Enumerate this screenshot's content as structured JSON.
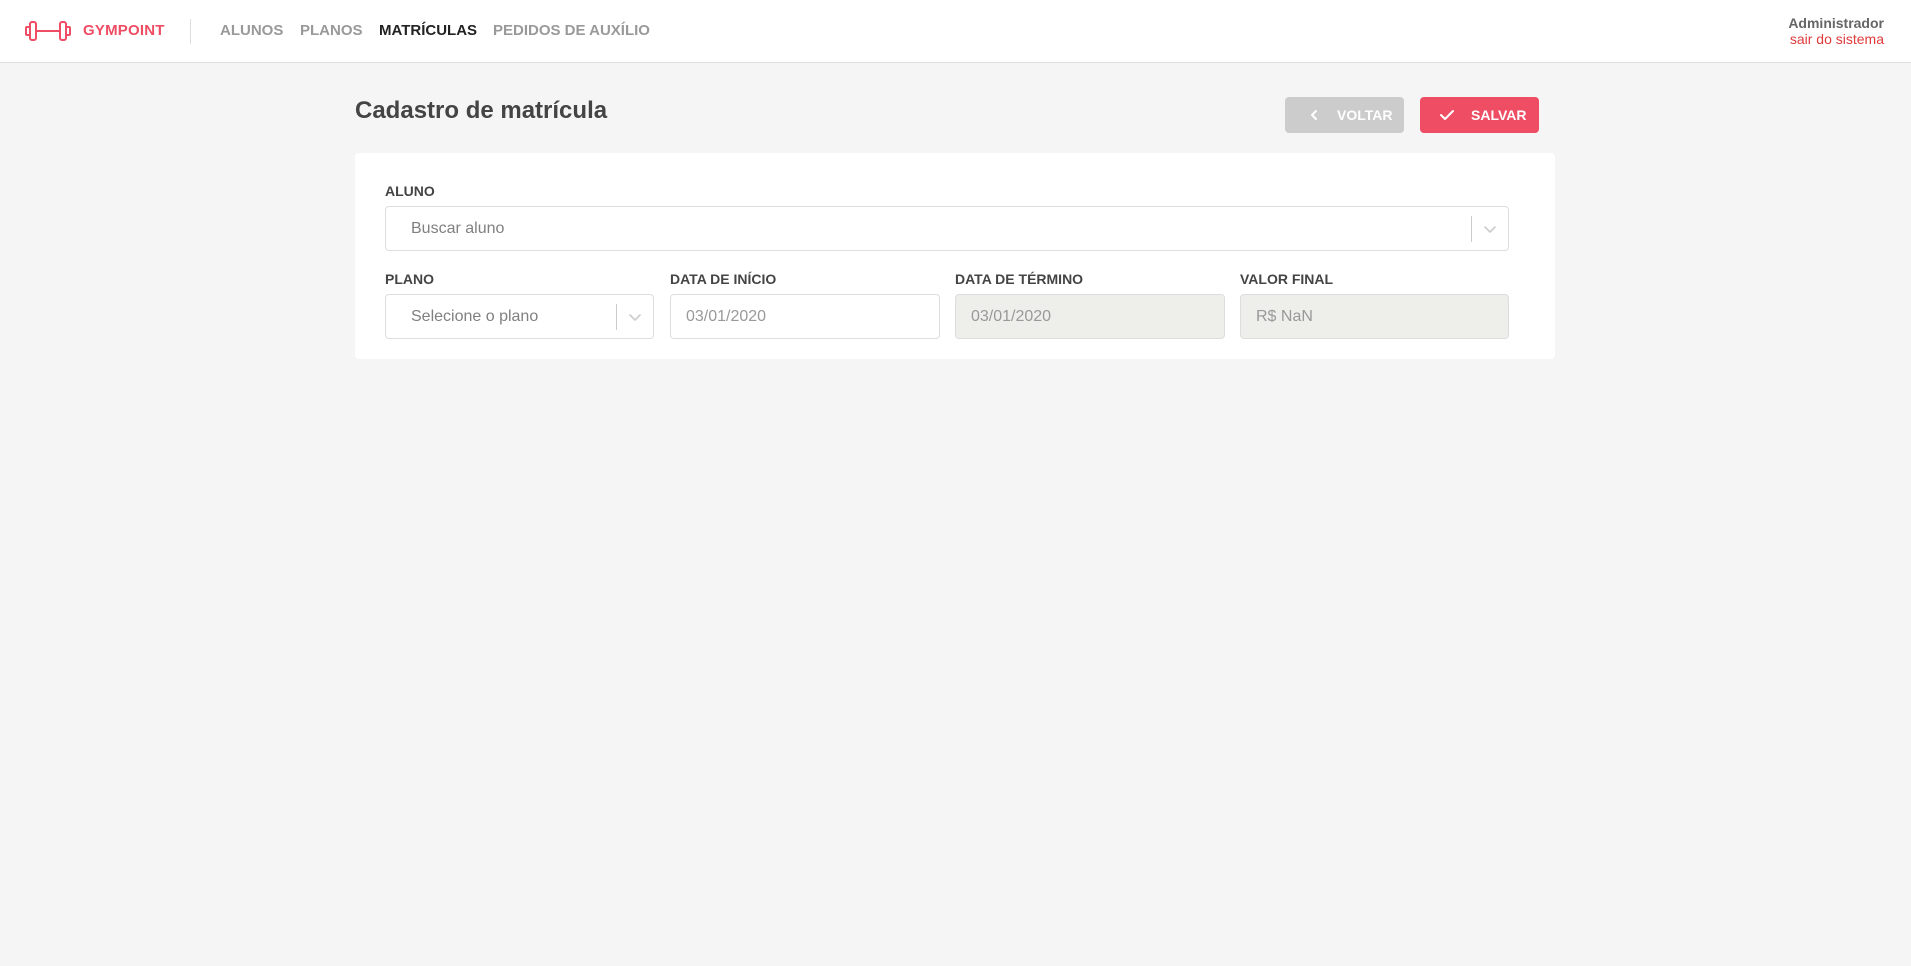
{
  "app": {
    "name": "GYMPOINT",
    "brand_color": "#ee4d64",
    "logo_icon": "dumbbell-icon"
  },
  "nav": {
    "items": [
      {
        "label": "ALUNOS",
        "active": false
      },
      {
        "label": "PLANOS",
        "active": false
      },
      {
        "label": "MATRÍCULAS",
        "active": true
      },
      {
        "label": "PEDIDOS DE AUXÍLIO",
        "active": false
      }
    ]
  },
  "user": {
    "name": "Administrador",
    "logout_label": "sair do sistema"
  },
  "page": {
    "title": "Cadastro de matrícula",
    "back_label": "VOLTAR",
    "back_icon": "chevron-left-icon",
    "save_label": "SALVAR",
    "save_icon": "check-icon"
  },
  "form": {
    "student": {
      "label": "ALUNO",
      "placeholder": "Buscar aluno"
    },
    "plan": {
      "label": "PLANO",
      "placeholder": "Selecione o plano"
    },
    "start_date": {
      "label": "DATA DE INÍCIO",
      "value": "03/01/2020"
    },
    "end_date": {
      "label": "DATA DE TÉRMINO",
      "value": "03/01/2020"
    },
    "final_value": {
      "label": "VALOR FINAL",
      "value": "R$ NaN"
    }
  }
}
